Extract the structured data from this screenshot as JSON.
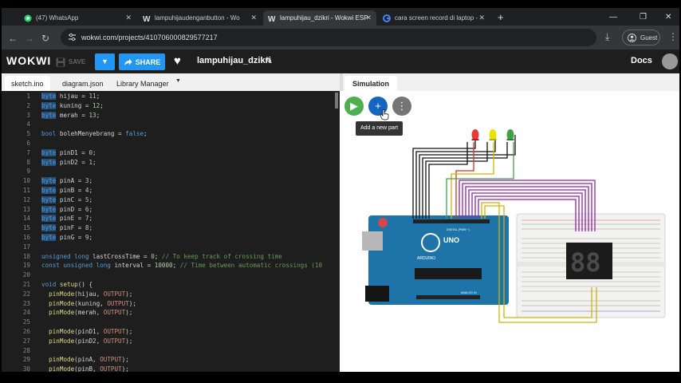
{
  "browser": {
    "tabs": [
      {
        "label": "(47) WhatsApp",
        "icon": "whatsapp-icon"
      },
      {
        "label": "lampuhijaudenganbutton - Wo",
        "icon": "wokwi-icon"
      },
      {
        "label": "lampuhijau_dzikri - Wokwi ESP",
        "icon": "wokwi-icon",
        "active": true
      },
      {
        "label": "cara screen record di laptop - ",
        "icon": "google-icon"
      }
    ],
    "url": "wokwi.com/projects/410706000829577217",
    "profile_label": "Guest"
  },
  "app": {
    "logo": "WOKWI",
    "save_label": "SAVE",
    "share_label": "SHARE",
    "project_name": "lampuhijau_dzikri",
    "docs_label": "Docs"
  },
  "editor_tabs": [
    {
      "label": "sketch.ino"
    },
    {
      "label": "diagram.json"
    },
    {
      "label": "Library Manager"
    }
  ],
  "simulation": {
    "tab_label": "Simulation",
    "tooltip": "Add a new part",
    "board_label": "UNO",
    "board_brand": "ARDUINO",
    "board_digital_label": "DIGITAL (PWM ~)",
    "board_analog_label": "ANALOG IN"
  },
  "colors": {
    "accent": "#2196f3",
    "run_green": "#4caf50",
    "led_red": "#e53935",
    "led_yellow": "#e5e500",
    "led_green": "#43a047",
    "wire_purple": "#8e24aa",
    "wire_yellow": "#d4b300",
    "board_blue": "#1e74a9"
  },
  "code_lines": [
    {
      "n": "1",
      "text": "byte hijau = 11;"
    },
    {
      "n": "2",
      "text": "byte kuning = 12;"
    },
    {
      "n": "3",
      "text": "byte merah = 13;"
    },
    {
      "n": "4",
      "text": ""
    },
    {
      "n": "5",
      "text": "bool bolehMenyebrang = false;"
    },
    {
      "n": "6",
      "text": ""
    },
    {
      "n": "7",
      "text": "byte pinD1 = 0;"
    },
    {
      "n": "8",
      "text": "byte pinD2 = 1;"
    },
    {
      "n": "9",
      "text": ""
    },
    {
      "n": "10",
      "text": "byte pinA = 3;"
    },
    {
      "n": "11",
      "text": "byte pinB = 4;"
    },
    {
      "n": "12",
      "text": "byte pinC = 5;"
    },
    {
      "n": "13",
      "text": "byte pinD = 6;"
    },
    {
      "n": "14",
      "text": "byte pinE = 7;"
    },
    {
      "n": "15",
      "text": "byte pinF = 8;"
    },
    {
      "n": "16",
      "text": "byte pinG = 9;"
    },
    {
      "n": "17",
      "text": ""
    },
    {
      "n": "18",
      "text": "unsigned long lastCrossTime = 0; // To keep track of crossing time"
    },
    {
      "n": "19",
      "text": "const unsigned long interval = 10000; // Time between automatic crossings (10"
    },
    {
      "n": "20",
      "text": ""
    },
    {
      "n": "21",
      "text": "void setup() {"
    },
    {
      "n": "22",
      "text": "  pinMode(hijau, OUTPUT);"
    },
    {
      "n": "23",
      "text": "  pinMode(kuning, OUTPUT);"
    },
    {
      "n": "24",
      "text": "  pinMode(merah, OUTPUT);"
    },
    {
      "n": "25",
      "text": ""
    },
    {
      "n": "26",
      "text": "  pinMode(pinD1, OUTPUT);"
    },
    {
      "n": "27",
      "text": "  pinMode(pinD2, OUTPUT);"
    },
    {
      "n": "28",
      "text": ""
    },
    {
      "n": "29",
      "text": "  pinMode(pinA, OUTPUT);"
    },
    {
      "n": "30",
      "text": "  pinMode(pinB, OUTPUT);"
    }
  ]
}
